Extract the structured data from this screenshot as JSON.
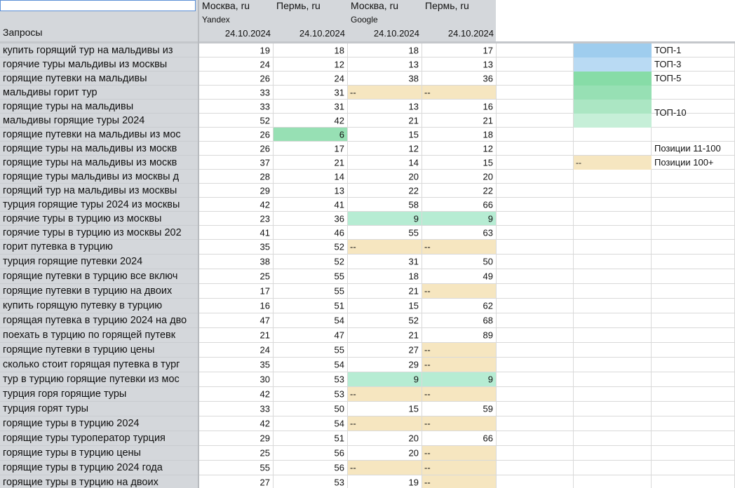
{
  "header": {
    "column_label": "Запросы",
    "columns": [
      {
        "city": "Москва, ru",
        "engine": "Yandex",
        "date": "24.10.2024"
      },
      {
        "city": "Пермь, ru",
        "engine": "",
        "date": "24.10.2024"
      },
      {
        "city": "Москва, ru",
        "engine": "Google",
        "date": "24.10.2024"
      },
      {
        "city": "Пермь, ru",
        "engine": "",
        "date": "24.10.2024"
      }
    ]
  },
  "colors": {
    "top1": "#9fcdee",
    "top3": "#b9daf3",
    "top5": "#87dca7",
    "top10a": "#97e0b4",
    "top10b": "#abe6c3",
    "top10c": "#c6efd8",
    "top10_cell": "#b6ecd3",
    "out100": "#f6e6c0"
  },
  "rows": [
    {
      "query": "купить горящий тур на мальдивы из",
      "values": [
        "19",
        "18",
        "18",
        "17"
      ],
      "fill": [
        "",
        "",
        "",
        ""
      ]
    },
    {
      "query": "горячие туры мальдивы из москвы",
      "values": [
        "24",
        "12",
        "13",
        "13"
      ],
      "fill": [
        "",
        "",
        "",
        ""
      ]
    },
    {
      "query": "горящие путевки на мальдивы",
      "values": [
        "26",
        "24",
        "38",
        "36"
      ],
      "fill": [
        "",
        "",
        "",
        ""
      ]
    },
    {
      "query": "мальдивы горит тур",
      "values": [
        "33",
        "31",
        "--",
        "--"
      ],
      "fill": [
        "",
        "",
        "out100",
        "out100"
      ]
    },
    {
      "query": "горящие туры на мальдивы",
      "values": [
        "33",
        "31",
        "13",
        "16"
      ],
      "fill": [
        "",
        "",
        "",
        ""
      ]
    },
    {
      "query": "мальдивы горящие туры 2024",
      "values": [
        "52",
        "42",
        "21",
        "21"
      ],
      "fill": [
        "",
        "",
        "",
        ""
      ]
    },
    {
      "query": "горящие путевки на мальдивы из мос",
      "values": [
        "26",
        "6",
        "15",
        "18"
      ],
      "fill": [
        "",
        "top10a",
        "",
        ""
      ]
    },
    {
      "query": "горящие туры на мальдивы из москв",
      "values": [
        "26",
        "17",
        "12",
        "12"
      ],
      "fill": [
        "",
        "",
        "",
        ""
      ]
    },
    {
      "query": "горящие туры на мальдивы из москв",
      "values": [
        "37",
        "21",
        "14",
        "15"
      ],
      "fill": [
        "",
        "",
        "",
        ""
      ]
    },
    {
      "query": "горящие туры мальдивы из москвы д",
      "values": [
        "28",
        "14",
        "20",
        "20"
      ],
      "fill": [
        "",
        "",
        "",
        ""
      ]
    },
    {
      "query": "горящий тур на мальдивы из москвы",
      "values": [
        "29",
        "13",
        "22",
        "22"
      ],
      "fill": [
        "",
        "",
        "",
        ""
      ]
    },
    {
      "query": "турция горящие туры 2024 из москвы",
      "values": [
        "42",
        "41",
        "58",
        "66"
      ],
      "fill": [
        "",
        "",
        "",
        ""
      ]
    },
    {
      "query": "горячие туры в турцию из москвы",
      "values": [
        "23",
        "36",
        "9",
        "9"
      ],
      "fill": [
        "",
        "",
        "top10_cell",
        "top10_cell"
      ]
    },
    {
      "query": "горячие туры в турцию из москвы 202",
      "values": [
        "41",
        "46",
        "55",
        "63"
      ],
      "fill": [
        "",
        "",
        "",
        ""
      ]
    },
    {
      "query": "горит путевка в турцию",
      "values": [
        "35",
        "52",
        "--",
        "--"
      ],
      "fill": [
        "",
        "",
        "out100",
        "out100"
      ]
    },
    {
      "query": "турция горящие путевки 2024",
      "values": [
        "38",
        "52",
        "31",
        "50"
      ],
      "fill": [
        "",
        "",
        "",
        ""
      ]
    },
    {
      "query": "горящие путевки в турцию все включ",
      "values": [
        "25",
        "55",
        "18",
        "49"
      ],
      "fill": [
        "",
        "",
        "",
        ""
      ]
    },
    {
      "query": "горящие путевки в турцию на двоих",
      "values": [
        "17",
        "55",
        "21",
        "--"
      ],
      "fill": [
        "",
        "",
        "",
        "out100"
      ]
    },
    {
      "query": "купить горящую путевку в турцию",
      "values": [
        "16",
        "51",
        "15",
        "62"
      ],
      "fill": [
        "",
        "",
        "",
        ""
      ]
    },
    {
      "query": "горящая путевка в турцию 2024 на дво",
      "values": [
        "47",
        "54",
        "52",
        "68"
      ],
      "fill": [
        "",
        "",
        "",
        ""
      ]
    },
    {
      "query": "поехать в турцию по горящей путевк",
      "values": [
        "21",
        "47",
        "21",
        "89"
      ],
      "fill": [
        "",
        "",
        "",
        ""
      ]
    },
    {
      "query": "горящие путевки в турцию цены",
      "values": [
        "24",
        "55",
        "27",
        "--"
      ],
      "fill": [
        "",
        "",
        "",
        "out100"
      ]
    },
    {
      "query": "сколько стоит горящая путевка в тург",
      "values": [
        "35",
        "54",
        "29",
        "--"
      ],
      "fill": [
        "",
        "",
        "",
        "out100"
      ]
    },
    {
      "query": "тур в турцию горящие путевки из мос",
      "values": [
        "30",
        "53",
        "9",
        "9"
      ],
      "fill": [
        "",
        "",
        "top10_cell",
        "top10_cell"
      ]
    },
    {
      "query": "турция горя горящие туры",
      "values": [
        "42",
        "53",
        "--",
        "--"
      ],
      "fill": [
        "",
        "",
        "out100",
        "out100"
      ]
    },
    {
      "query": "турция горят туры",
      "values": [
        "33",
        "50",
        "15",
        "59"
      ],
      "fill": [
        "",
        "",
        "",
        ""
      ]
    },
    {
      "query": "горящие туры в турцию 2024",
      "values": [
        "42",
        "54",
        "--",
        "--"
      ],
      "fill": [
        "",
        "",
        "out100",
        "out100"
      ]
    },
    {
      "query": "горящие туры туроператор турция",
      "values": [
        "29",
        "51",
        "20",
        "66"
      ],
      "fill": [
        "",
        "",
        "",
        ""
      ]
    },
    {
      "query": "горящие туры в турцию цены",
      "values": [
        "25",
        "56",
        "20",
        "--"
      ],
      "fill": [
        "",
        "",
        "",
        "out100"
      ]
    },
    {
      "query": "горящие туры в турцию 2024 года",
      "values": [
        "55",
        "56",
        "--",
        "--"
      ],
      "fill": [
        "",
        "",
        "out100",
        "out100"
      ]
    },
    {
      "query": "горящие туры в турцию на двоих",
      "values": [
        "27",
        "53",
        "19",
        "--"
      ],
      "fill": [
        "",
        "",
        "",
        "out100"
      ]
    }
  ],
  "legend": {
    "top1": "ТОП-1",
    "top3": "ТОП-3",
    "top5": "ТОП-5",
    "top10": "ТОП-10",
    "pos_11_100": "Позиции 11-100",
    "pos_100_plus": "Позиции 100+",
    "dash": "--"
  }
}
